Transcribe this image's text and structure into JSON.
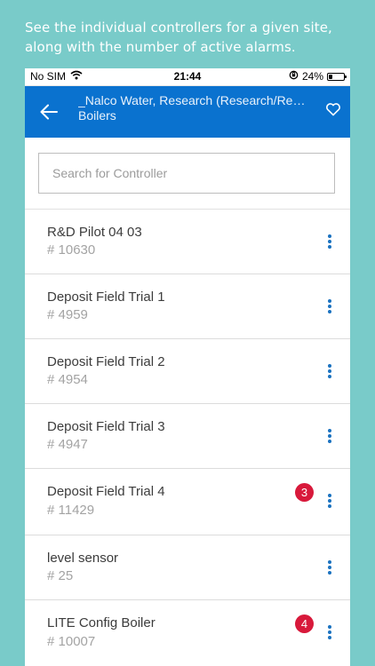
{
  "caption": "See the individual controllers for a given site, along with the number of active alarms.",
  "status_bar": {
    "carrier": "No SIM",
    "time": "21:44",
    "battery": "24%",
    "battery_level": 0.24
  },
  "header": {
    "title": "_Nalco Water, Research (Research/Rese...",
    "subtitle": "Boilers"
  },
  "search": {
    "placeholder": "Search for Controller",
    "value": ""
  },
  "controllers": [
    {
      "name": "R&D Pilot 04 03",
      "id": "# 10630",
      "alarms": ""
    },
    {
      "name": "Deposit Field Trial 1",
      "id": "# 4959",
      "alarms": ""
    },
    {
      "name": "Deposit Field Trial 2",
      "id": "# 4954",
      "alarms": ""
    },
    {
      "name": "Deposit Field Trial 3",
      "id": "# 4947",
      "alarms": ""
    },
    {
      "name": "Deposit Field Trial 4",
      "id": "# 11429",
      "alarms": "3"
    },
    {
      "name": "level sensor",
      "id": "# 25",
      "alarms": ""
    },
    {
      "name": "LITE Config Boiler",
      "id": "# 10007",
      "alarms": "4"
    }
  ],
  "colors": {
    "background": "#79cbc9",
    "header": "#0a72cf",
    "alarm_badge": "#d8193b",
    "more_icon": "#1a72c0"
  }
}
